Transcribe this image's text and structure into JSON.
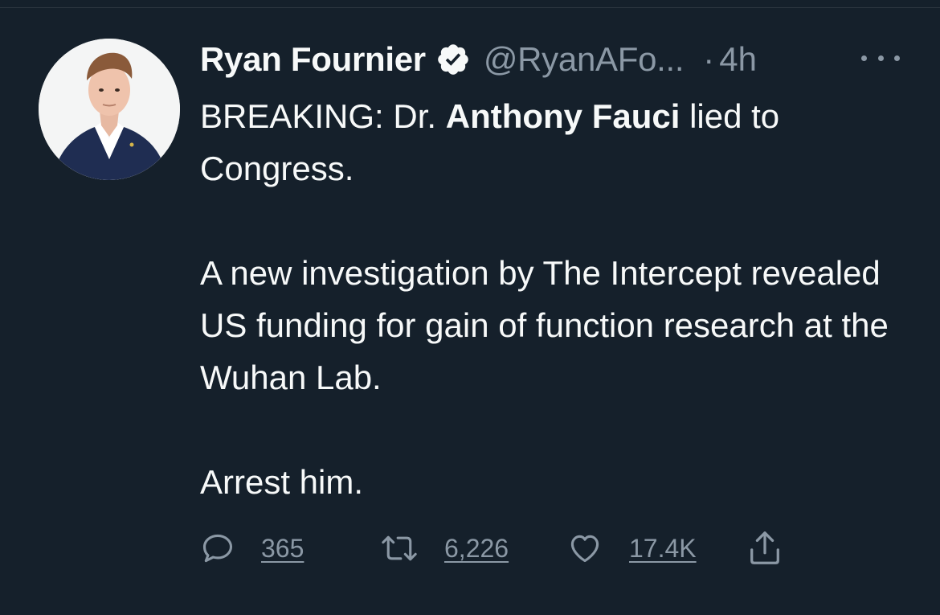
{
  "tweet": {
    "author": {
      "display_name": "Ryan Fournier",
      "handle": "@RyanAFo...",
      "verified": true
    },
    "time_separator": "·",
    "timestamp": "4h",
    "body": {
      "p1_a": "BREAKING: Dr. ",
      "p1_bold": "Anthony Fauci",
      "p1_b": " lied to Congress.",
      "p2": "A new investigation by The Intercept revealed US funding for gain of function research at the Wuhan Lab.",
      "p3": "Arrest him."
    },
    "actions": {
      "replies": "365",
      "retweets": "6,226",
      "likes": "17.4K"
    }
  },
  "icons": {
    "verified": "verified-badge-icon",
    "more": "more-dots-icon",
    "reply": "reply-bubble-icon",
    "retweet": "retweet-arrows-icon",
    "like": "heart-icon",
    "share": "share-upload-icon"
  },
  "colors": {
    "background": "#15202b",
    "text_primary": "#f7f9f9",
    "text_secondary": "#8b98a5",
    "divider": "#2c3640"
  }
}
